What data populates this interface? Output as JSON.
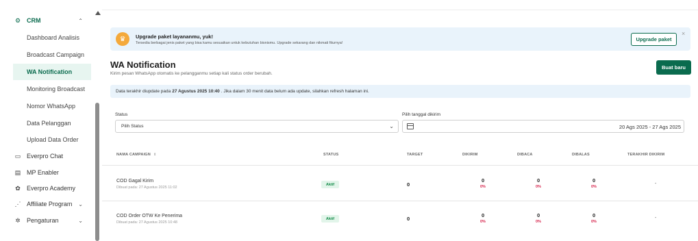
{
  "sidebar": {
    "crm_label": "CRM",
    "crm_children": [
      {
        "label": "Dashboard Analisis",
        "active": false
      },
      {
        "label": "Broadcast Campaign",
        "active": false
      },
      {
        "label": "WA Notification",
        "active": true
      },
      {
        "label": "Monitoring Broadcast",
        "active": false
      },
      {
        "label": "Nomor WhatsApp",
        "active": false
      },
      {
        "label": "Data Pelanggan",
        "active": false
      },
      {
        "label": "Upload Data Order",
        "active": false
      }
    ],
    "items": [
      {
        "label": "Everpro Chat",
        "icon": "chat-icon"
      },
      {
        "label": "MP Enabler",
        "icon": "store-icon"
      },
      {
        "label": "Everpro Academy",
        "icon": "academy-icon"
      },
      {
        "label": "Affiliate Program",
        "icon": "affiliate-icon"
      },
      {
        "label": "Pengaturan",
        "icon": "gear-icon"
      }
    ]
  },
  "banner": {
    "title": "Upgrade paket layananmu, yuk!",
    "subtitle": "Tersedia berbagai jenis paket yang bisa kamu sesuaikan untuk kebutuhan bisnismu. Upgrade sekarang dan nikmati fiturnya!",
    "button": "Upgrade paket",
    "close": "×"
  },
  "page": {
    "title": "WA Notification",
    "subtitle": "Kirim pesan WhatsApp otomatis ke pelangganmu setiap kali status order berubah.",
    "new_button": "Buat baru"
  },
  "info": {
    "prefix": "Data terakhir diupdate pada",
    "timestamp": "27 Agustus 2025 10:40",
    "suffix": ". Jika dalam 30 menit data belum ada update, silahkan refresh halaman ini."
  },
  "filters": {
    "status_label": "Status",
    "status_value": "Pilih Status",
    "date_label": "Pilih tanggal dikirim",
    "date_value": "20 Ags 2025 - 27 Ags 2025"
  },
  "table": {
    "headers": [
      "NAMA CAMPAIGN",
      "STATUS",
      "TARGET",
      "DIKIRIM",
      "DIBACA",
      "DIBALAS",
      "TERAKHIR DIKIRIM"
    ],
    "rows": [
      {
        "name": "COD Gagal Kirim",
        "created": "Dibuat pada: 27 Agustus 2025 11:02",
        "status": "Aktif",
        "target": "0",
        "dikirim": "0",
        "dikirim_pct": "0%",
        "dibaca": "0",
        "dibaca_pct": "0%",
        "dibalas": "0",
        "dibalas_pct": "0%",
        "last": "-"
      },
      {
        "name": "COD Order OTW Ke Penerima",
        "created": "Dibuat pada: 27 Agustus 2025 10:48",
        "status": "Aktif",
        "target": "0",
        "dikirim": "0",
        "dikirim_pct": "0%",
        "dibaca": "0",
        "dibaca_pct": "0%",
        "dibalas": "0",
        "dibalas_pct": "0%",
        "last": "-"
      }
    ]
  },
  "colors": {
    "brand": "#0a6b4e",
    "danger": "#d6224a",
    "badge_bg": "#e2f5ea",
    "info_bg": "#e9f3fb"
  }
}
